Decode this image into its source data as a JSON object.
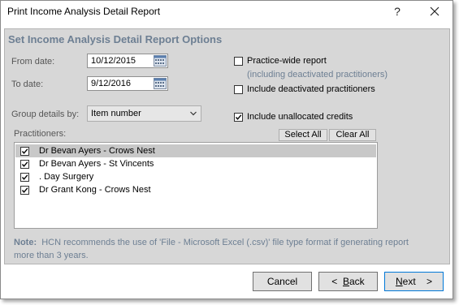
{
  "window": {
    "title": "Print Income Analysis Detail Report",
    "help_label": "?",
    "close_label": "✕"
  },
  "options": {
    "heading": "Set Income Analysis Detail Report Options",
    "from_date_label": "From date:",
    "from_date_value": "10/12/2015",
    "to_date_label": "To date:",
    "to_date_value": "9/12/2016",
    "group_label": "Group details by:",
    "group_value": "Item number",
    "practice_wide_label": "Practice-wide report",
    "practice_wide_checked": false,
    "practice_wide_note": "(including deactivated practitioners)",
    "include_deactivated_label": "Include deactivated practitioners",
    "include_deactivated_checked": false,
    "include_unallocated_label": "Include unallocated credits",
    "include_unallocated_checked": true
  },
  "practitioners": {
    "label": "Practitioners:",
    "select_all_label": "Select All",
    "clear_all_label": "Clear All",
    "items": [
      {
        "name": "Dr Bevan Ayers - Crows Nest",
        "checked": true,
        "selected": true
      },
      {
        "name": "Dr Bevan Ayers - St Vincents",
        "checked": true,
        "selected": false
      },
      {
        "name": ". Day Surgery",
        "checked": true,
        "selected": false
      },
      {
        "name": "Dr Grant Kong - Crows Nest",
        "checked": true,
        "selected": false
      }
    ]
  },
  "note": {
    "prefix": "Note:",
    "text": "HCN recommends the use of 'File - Microsoft Excel (.csv)' file type format if generating report more than 3 years."
  },
  "footer": {
    "cancel_label": "Cancel",
    "back_arrow": "<",
    "back_key": "B",
    "back_rest": "ack",
    "next_key": "N",
    "next_rest": "ext",
    "next_arrow": ">"
  }
}
